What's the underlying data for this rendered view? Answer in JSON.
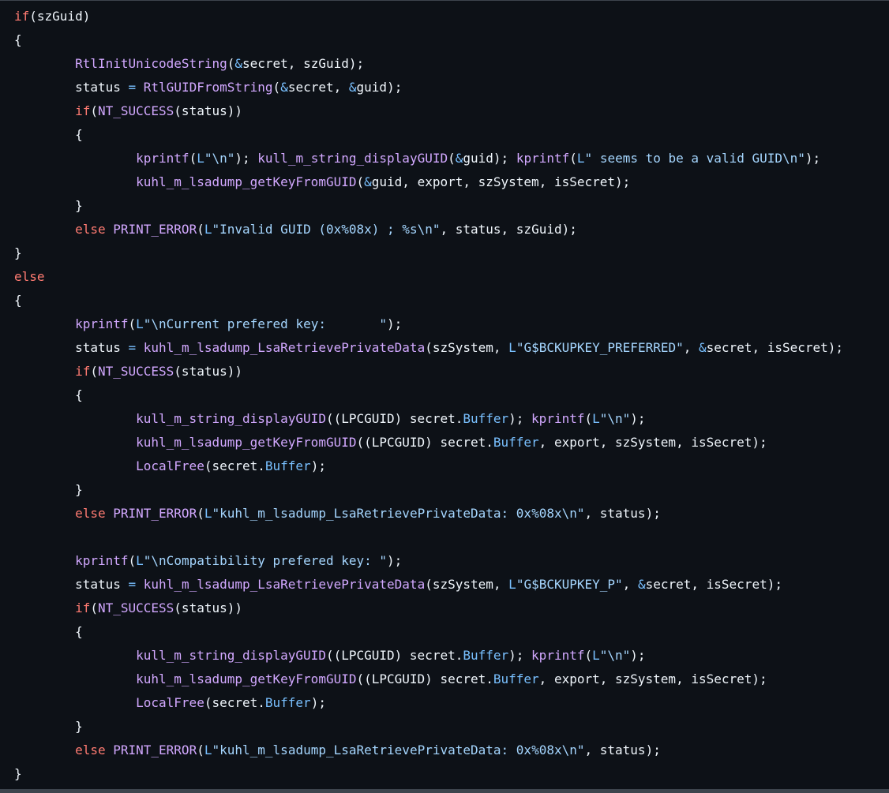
{
  "colors": {
    "background": "#0d1117",
    "keyword": "#ff7b72",
    "function": "#d2a8ff",
    "string": "#a5d6ff",
    "constant": "#79c0ff",
    "text": "#f0f6fc"
  },
  "code": {
    "lines": [
      [
        [
          "kw",
          "if"
        ],
        [
          "plain",
          "(szGuid)"
        ]
      ],
      [
        [
          "plain",
          "{"
        ]
      ],
      [
        [
          "plain",
          "        "
        ],
        [
          "fn",
          "RtlInitUnicodeString"
        ],
        [
          "plain",
          "("
        ],
        [
          "const",
          "&"
        ],
        [
          "plain",
          "secret, szGuid);"
        ]
      ],
      [
        [
          "plain",
          "        status "
        ],
        [
          "const",
          "="
        ],
        [
          "plain",
          " "
        ],
        [
          "fn",
          "RtlGUIDFromString"
        ],
        [
          "plain",
          "("
        ],
        [
          "const",
          "&"
        ],
        [
          "plain",
          "secret, "
        ],
        [
          "const",
          "&"
        ],
        [
          "plain",
          "guid);"
        ]
      ],
      [
        [
          "plain",
          "        "
        ],
        [
          "kw",
          "if"
        ],
        [
          "plain",
          "("
        ],
        [
          "fn",
          "NT_SUCCESS"
        ],
        [
          "plain",
          "(status))"
        ]
      ],
      [
        [
          "plain",
          "        {"
        ]
      ],
      [
        [
          "plain",
          "                "
        ],
        [
          "fn",
          "kprintf"
        ],
        [
          "plain",
          "("
        ],
        [
          "const",
          "L"
        ],
        [
          "str",
          "\"\\n\""
        ],
        [
          "plain",
          "); "
        ],
        [
          "fn",
          "kull_m_string_displayGUID"
        ],
        [
          "plain",
          "("
        ],
        [
          "const",
          "&"
        ],
        [
          "plain",
          "guid); "
        ],
        [
          "fn",
          "kprintf"
        ],
        [
          "plain",
          "("
        ],
        [
          "const",
          "L"
        ],
        [
          "str",
          "\" seems to be a valid GUID\\n\""
        ],
        [
          "plain",
          ");"
        ]
      ],
      [
        [
          "plain",
          "                "
        ],
        [
          "fn",
          "kuhl_m_lsadump_getKeyFromGUID"
        ],
        [
          "plain",
          "("
        ],
        [
          "const",
          "&"
        ],
        [
          "plain",
          "guid, export, szSystem, isSecret);"
        ]
      ],
      [
        [
          "plain",
          "        }"
        ]
      ],
      [
        [
          "plain",
          "        "
        ],
        [
          "kw",
          "else"
        ],
        [
          "plain",
          " "
        ],
        [
          "fn",
          "PRINT_ERROR"
        ],
        [
          "plain",
          "("
        ],
        [
          "const",
          "L"
        ],
        [
          "str",
          "\"Invalid GUID (0x%08x) ; %s\\n\""
        ],
        [
          "plain",
          ", status, szGuid);"
        ]
      ],
      [
        [
          "plain",
          "}"
        ]
      ],
      [
        [
          "kw",
          "else"
        ]
      ],
      [
        [
          "plain",
          "{"
        ]
      ],
      [
        [
          "plain",
          "        "
        ],
        [
          "fn",
          "kprintf"
        ],
        [
          "plain",
          "("
        ],
        [
          "const",
          "L"
        ],
        [
          "str",
          "\"\\nCurrent prefered key:       \""
        ],
        [
          "plain",
          ");"
        ]
      ],
      [
        [
          "plain",
          "        status "
        ],
        [
          "const",
          "="
        ],
        [
          "plain",
          " "
        ],
        [
          "fn",
          "kuhl_m_lsadump_LsaRetrievePrivateData"
        ],
        [
          "plain",
          "(szSystem, "
        ],
        [
          "const",
          "L"
        ],
        [
          "str",
          "\"G$BCKUPKEY_PREFERRED\""
        ],
        [
          "plain",
          ", "
        ],
        [
          "const",
          "&"
        ],
        [
          "plain",
          "secret, isSecret);"
        ]
      ],
      [
        [
          "plain",
          "        "
        ],
        [
          "kw",
          "if"
        ],
        [
          "plain",
          "("
        ],
        [
          "fn",
          "NT_SUCCESS"
        ],
        [
          "plain",
          "(status))"
        ]
      ],
      [
        [
          "plain",
          "        {"
        ]
      ],
      [
        [
          "plain",
          "                "
        ],
        [
          "fn",
          "kull_m_string_displayGUID"
        ],
        [
          "plain",
          "((LPCGUID) secret."
        ],
        [
          "const",
          "Buffer"
        ],
        [
          "plain",
          "); "
        ],
        [
          "fn",
          "kprintf"
        ],
        [
          "plain",
          "("
        ],
        [
          "const",
          "L"
        ],
        [
          "str",
          "\"\\n\""
        ],
        [
          "plain",
          ");"
        ]
      ],
      [
        [
          "plain",
          "                "
        ],
        [
          "fn",
          "kuhl_m_lsadump_getKeyFromGUID"
        ],
        [
          "plain",
          "((LPCGUID) secret."
        ],
        [
          "const",
          "Buffer"
        ],
        [
          "plain",
          ", export, szSystem, isSecret);"
        ]
      ],
      [
        [
          "plain",
          "                "
        ],
        [
          "fn",
          "LocalFree"
        ],
        [
          "plain",
          "(secret."
        ],
        [
          "const",
          "Buffer"
        ],
        [
          "plain",
          ");"
        ]
      ],
      [
        [
          "plain",
          "        }"
        ]
      ],
      [
        [
          "plain",
          "        "
        ],
        [
          "kw",
          "else"
        ],
        [
          "plain",
          " "
        ],
        [
          "fn",
          "PRINT_ERROR"
        ],
        [
          "plain",
          "("
        ],
        [
          "const",
          "L"
        ],
        [
          "str",
          "\"kuhl_m_lsadump_LsaRetrievePrivateData: 0x%08x\\n\""
        ],
        [
          "plain",
          ", status);"
        ]
      ],
      [
        [
          "plain",
          ""
        ]
      ],
      [
        [
          "plain",
          "        "
        ],
        [
          "fn",
          "kprintf"
        ],
        [
          "plain",
          "("
        ],
        [
          "const",
          "L"
        ],
        [
          "str",
          "\"\\nCompatibility prefered key: \""
        ],
        [
          "plain",
          ");"
        ]
      ],
      [
        [
          "plain",
          "        status "
        ],
        [
          "const",
          "="
        ],
        [
          "plain",
          " "
        ],
        [
          "fn",
          "kuhl_m_lsadump_LsaRetrievePrivateData"
        ],
        [
          "plain",
          "(szSystem, "
        ],
        [
          "const",
          "L"
        ],
        [
          "str",
          "\"G$BCKUPKEY_P\""
        ],
        [
          "plain",
          ", "
        ],
        [
          "const",
          "&"
        ],
        [
          "plain",
          "secret, isSecret);"
        ]
      ],
      [
        [
          "plain",
          "        "
        ],
        [
          "kw",
          "if"
        ],
        [
          "plain",
          "("
        ],
        [
          "fn",
          "NT_SUCCESS"
        ],
        [
          "plain",
          "(status))"
        ]
      ],
      [
        [
          "plain",
          "        {"
        ]
      ],
      [
        [
          "plain",
          "                "
        ],
        [
          "fn",
          "kull_m_string_displayGUID"
        ],
        [
          "plain",
          "((LPCGUID) secret."
        ],
        [
          "const",
          "Buffer"
        ],
        [
          "plain",
          "); "
        ],
        [
          "fn",
          "kprintf"
        ],
        [
          "plain",
          "("
        ],
        [
          "const",
          "L"
        ],
        [
          "str",
          "\"\\n\""
        ],
        [
          "plain",
          ");"
        ]
      ],
      [
        [
          "plain",
          "                "
        ],
        [
          "fn",
          "kuhl_m_lsadump_getKeyFromGUID"
        ],
        [
          "plain",
          "((LPCGUID) secret."
        ],
        [
          "const",
          "Buffer"
        ],
        [
          "plain",
          ", export, szSystem, isSecret);"
        ]
      ],
      [
        [
          "plain",
          "                "
        ],
        [
          "fn",
          "LocalFree"
        ],
        [
          "plain",
          "(secret."
        ],
        [
          "const",
          "Buffer"
        ],
        [
          "plain",
          ");"
        ]
      ],
      [
        [
          "plain",
          "        }"
        ]
      ],
      [
        [
          "plain",
          "        "
        ],
        [
          "kw",
          "else"
        ],
        [
          "plain",
          " "
        ],
        [
          "fn",
          "PRINT_ERROR"
        ],
        [
          "plain",
          "("
        ],
        [
          "const",
          "L"
        ],
        [
          "str",
          "\"kuhl_m_lsadump_LsaRetrievePrivateData: 0x%08x\\n\""
        ],
        [
          "plain",
          ", status);"
        ]
      ],
      [
        [
          "plain",
          "}"
        ]
      ]
    ]
  }
}
